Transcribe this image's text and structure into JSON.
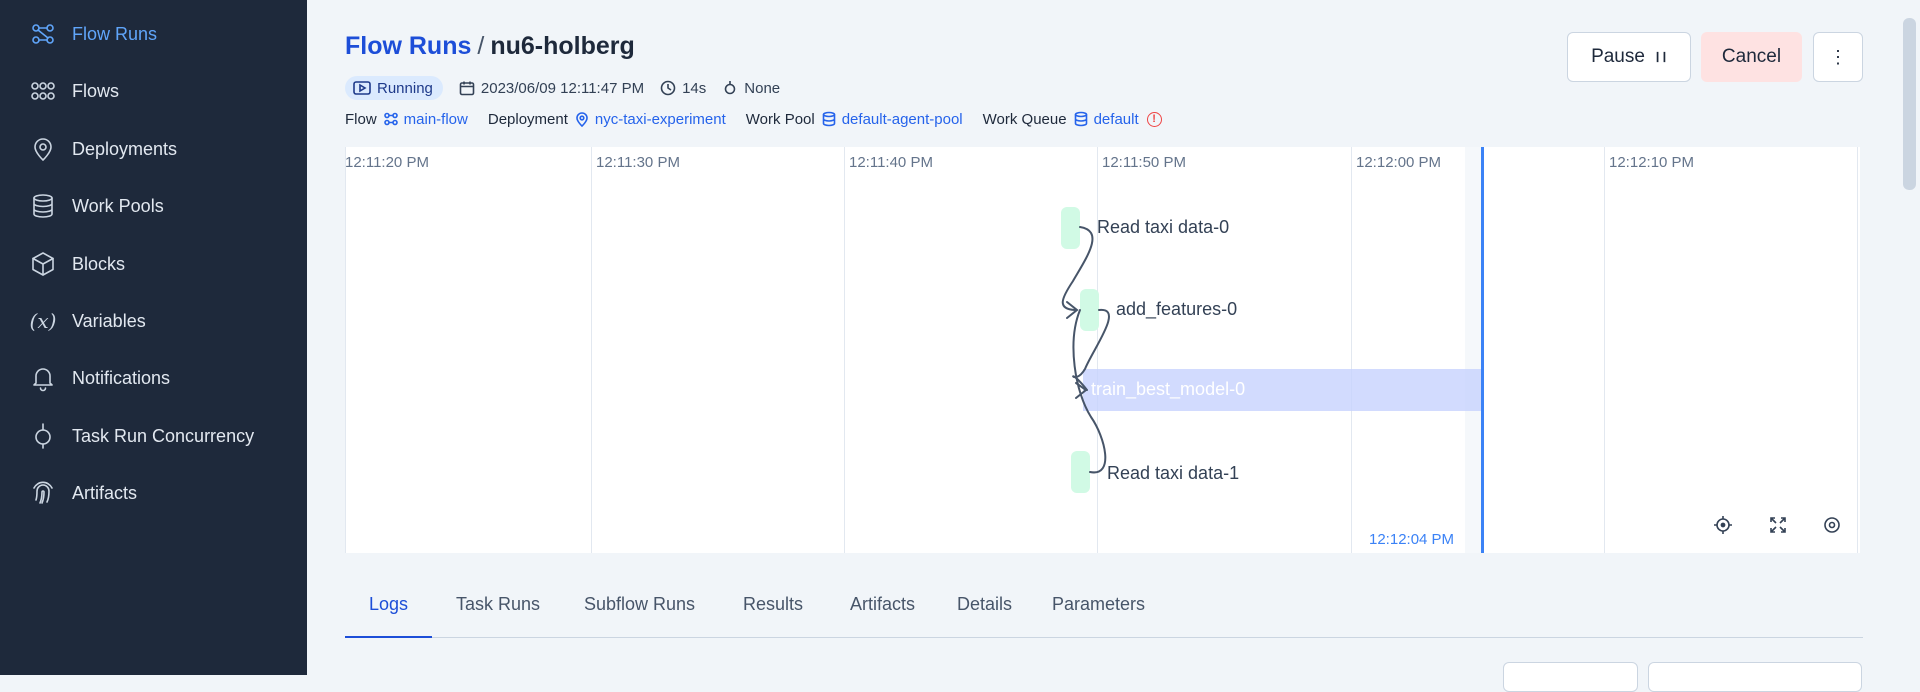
{
  "sidebar": {
    "items": [
      {
        "label": "Flow Runs",
        "icon": "flow-runs-icon",
        "active": true
      },
      {
        "label": "Flows",
        "icon": "flows-icon"
      },
      {
        "label": "Deployments",
        "icon": "map-pin-icon"
      },
      {
        "label": "Work Pools",
        "icon": "database-icon"
      },
      {
        "label": "Blocks",
        "icon": "cube-icon"
      },
      {
        "label": "Variables",
        "icon": "variable-icon"
      },
      {
        "label": "Notifications",
        "icon": "bell-icon"
      },
      {
        "label": "Task Run Concurrency",
        "icon": "concurrency-icon"
      },
      {
        "label": "Artifacts",
        "icon": "fingerprint-icon"
      }
    ]
  },
  "header": {
    "breadcrumb_link": "Flow Runs",
    "separator": "/",
    "run_name": "nu6-holberg",
    "state": "Running",
    "start_time": "2023/06/09 12:11:47 PM",
    "duration": "14s",
    "tags": "None",
    "flow_key": "Flow",
    "flow_value": "main-flow",
    "deployment_key": "Deployment",
    "deployment_value": "nyc-taxi-experiment",
    "work_pool_key": "Work Pool",
    "work_pool_value": "default-agent-pool",
    "work_queue_key": "Work Queue",
    "work_queue_value": "default",
    "work_queue_status": "!"
  },
  "actions": {
    "pause_label": "Pause",
    "cancel_label": "Cancel",
    "more_label": "⋮"
  },
  "timeline": {
    "ticks": [
      "12:11:20 PM",
      "12:11:30 PM",
      "12:11:40 PM",
      "12:11:50 PM",
      "12:12:00 PM",
      "12:12:10 PM"
    ],
    "now_label": "12:12:04 PM",
    "nodes": [
      {
        "label": "Read taxi data-0"
      },
      {
        "label": "add_features-0"
      },
      {
        "label": "train_best_model-0"
      },
      {
        "label": "Read taxi data-1"
      }
    ],
    "colors": {
      "completed": "#d1fae5",
      "running": "#c7d2fe",
      "now": "#3b82f6"
    }
  },
  "tabs": [
    "Logs",
    "Task Runs",
    "Subflow Runs",
    "Results",
    "Artifacts",
    "Details",
    "Parameters"
  ]
}
